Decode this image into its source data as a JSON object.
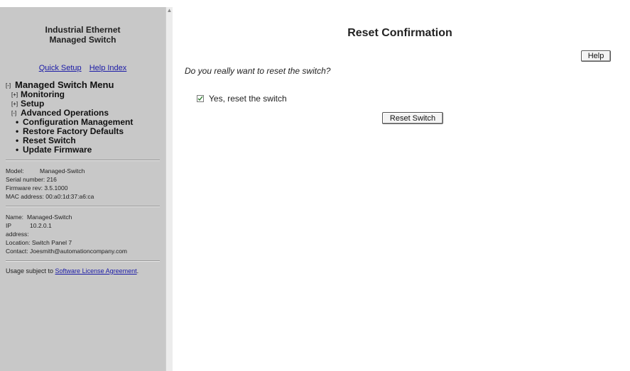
{
  "sidebar": {
    "title_line1": "Industrial Ethernet",
    "title_line2": "Managed Switch",
    "links": {
      "quick_setup": "Quick Setup",
      "help_index": "Help Index"
    },
    "menu": {
      "root": {
        "toggle": "[-]",
        "label": "Managed Switch Menu"
      },
      "monitoring": {
        "toggle": "[+]",
        "label": "Monitoring"
      },
      "setup": {
        "toggle": "[+]",
        "label": "Setup"
      },
      "advanced": {
        "toggle": "[-]",
        "label": "Advanced Operations"
      },
      "items": [
        "Configuration Management",
        "Restore Factory Defaults",
        "Reset Switch",
        "Update Firmware"
      ]
    },
    "device": {
      "model_label": "Model:",
      "model_value": "Managed-Switch",
      "serial_label": "Serial number:",
      "serial_value": "216",
      "firmware_label": "Firmware rev:",
      "firmware_value": "3.5.1000",
      "mac_label": "MAC address:",
      "mac_value": "00:a0:1d:37:a6:ca"
    },
    "network": {
      "name_label": "Name:",
      "name_value": "Managed-Switch",
      "ip_label": "IP address:",
      "ip_value": "10.2.0.1",
      "location_label": "Location:",
      "location_value": "Switch Panel 7",
      "contact_label": "Contact:",
      "contact_value": "Joesmith@automationcompany.com"
    },
    "usage": {
      "prefix": "Usage subject to ",
      "link": "Software License Agreement",
      "suffix": "."
    }
  },
  "main": {
    "title": "Reset Confirmation",
    "help_label": "Help",
    "question": "Do you really want to reset the switch?",
    "checkbox_label": "Yes, reset the switch",
    "checkbox_checked": true,
    "reset_button": "Reset Switch"
  }
}
